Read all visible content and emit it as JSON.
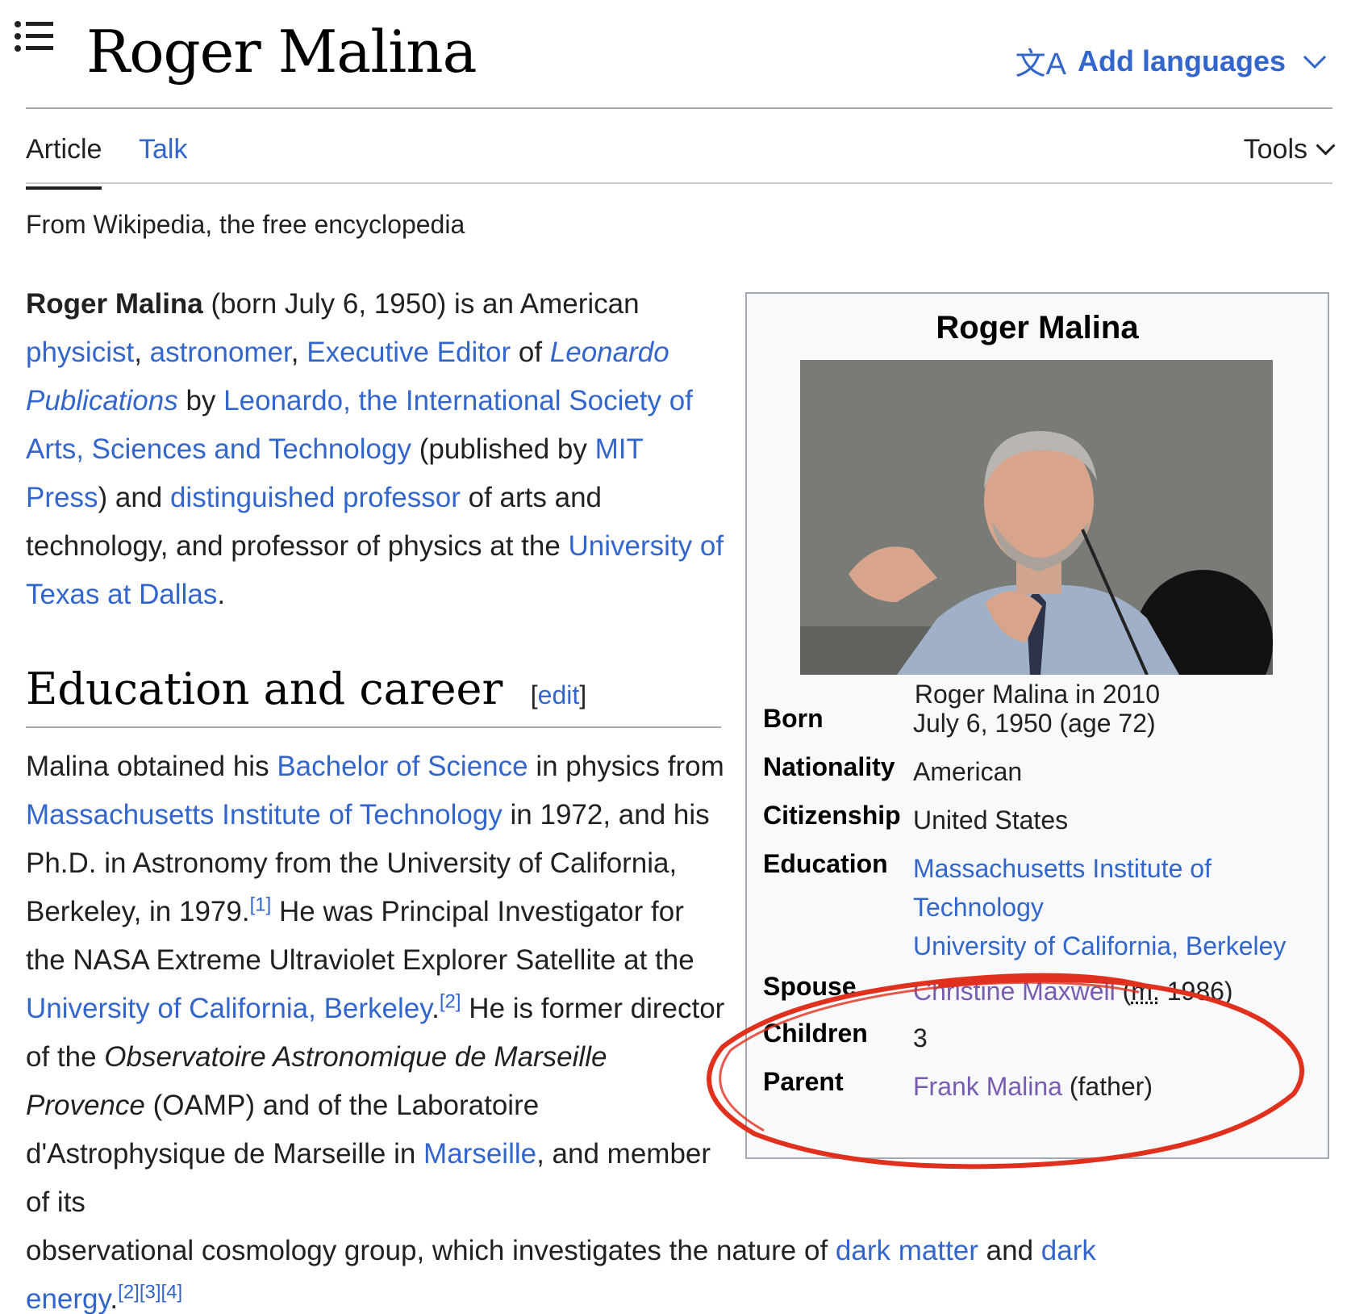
{
  "header": {
    "title": "Roger Malina",
    "add_languages": "Add languages",
    "lang_icon": "文A"
  },
  "tabs": {
    "article": "Article",
    "talk": "Talk",
    "tools": "Tools"
  },
  "tagline": "From Wikipedia, the free encyclopedia",
  "intro": {
    "name": "Roger Malina",
    "t1": " (born July 6, 1950) is an American ",
    "l_physicist": "physicist",
    "t2": ", ",
    "l_astronomer": "astronomer",
    "t3": ", ",
    "l_exec_editor": "Executive Editor",
    "t4": " of ",
    "l_leonardo_pub": "Leonardo Publications",
    "t5": " by ",
    "l_leonardo_soc": "Leonardo, the International Society of Arts, Sciences and Technology",
    "t6": " (published by ",
    "l_mit_press": "MIT Press",
    "t7": ") and ",
    "l_dist_prof": "distinguished professor",
    "t8": " of arts and technology, and professor of physics at the ",
    "l_utd": "University of Texas at Dallas",
    "t9": "."
  },
  "section": {
    "heading": "Education and career",
    "edit_open": "[",
    "edit": "edit",
    "edit_close": "]"
  },
  "career": {
    "t1": "Malina obtained his ",
    "l_bsc": "Bachelor of Science",
    "t2": " in physics from ",
    "l_mit": "Massachusetts Institute of Technology",
    "t3": " in 1972, and his Ph.D. in Astronomy from the University of California, Berkeley, in 1979.",
    "ref1": "[1]",
    "t4": " He was Principal Investigator for the NASA Extreme Ultraviolet Explorer Satellite at the ",
    "l_ucb": "University of California, Berkeley",
    "t5": ".",
    "ref2": "[2]",
    "t6": " He is former director of the ",
    "oamp": "Observatoire Astronomique de Marseille Provence",
    "t7": " (OAMP) and of the Laboratoire d'Astrophysique de Marseille in ",
    "l_marseille": "Marseille",
    "t8": ", and member of its",
    "t9": "observational cosmology group, which investigates the nature of ",
    "l_dark_matter": "dark matter",
    "t10": " and ",
    "l_dark_energy": "dark energy",
    "t11": ".",
    "refs_end": "[2][3][4]"
  },
  "infobox": {
    "title": "Roger Malina",
    "caption": "Roger Malina in 2010",
    "born_label": "Born",
    "born_value": "July 6, 1950 (age 72)",
    "nationality_label": "Nationality",
    "nationality_value": "American",
    "citizenship_label": "Citizenship",
    "citizenship_value": "United States",
    "education_label": "Education",
    "education_1": "Massachusetts Institute of Technology",
    "education_2": "University of California, Berkeley",
    "spouse_label": "Spouse",
    "spouse_link": "Christine Maxwell",
    "spouse_open": " (",
    "spouse_m": "m.",
    "spouse_year": " 1986)",
    "children_label": "Children",
    "children_value": "3",
    "parent_label": "Parent",
    "parent_link": "Frank Malina",
    "parent_rel": " (father)"
  },
  "colors": {
    "link": "#3366cc",
    "visited_link": "#795cb2",
    "annotation": "#e0301e",
    "infobox_bg": "#f8f9fa"
  },
  "icons": [
    "menu-icon",
    "translate-icon",
    "chevron-down-icon"
  ]
}
